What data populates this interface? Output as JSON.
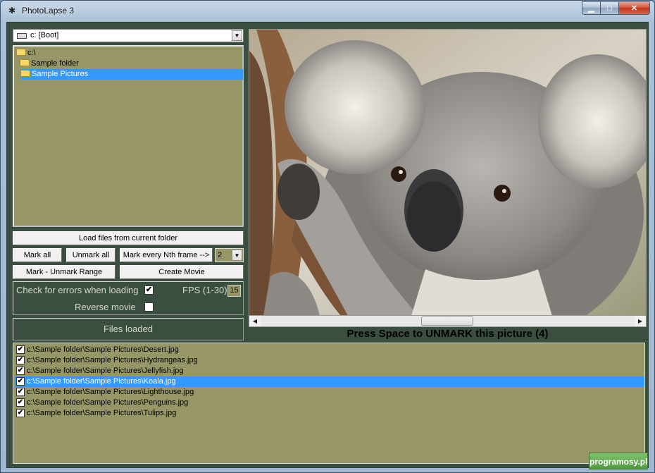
{
  "window": {
    "title": "PhotoLapse 3",
    "icon": "bug-icon",
    "controls": {
      "minimize": "▁",
      "maximize": "□",
      "close": "✕"
    }
  },
  "drive_selector": {
    "value": "c: [Boot]"
  },
  "folder_tree": {
    "items": [
      {
        "label": "c:\\"
      },
      {
        "label": "Sample folder"
      },
      {
        "label": "Sample Pictures",
        "selected": true
      }
    ]
  },
  "buttons": {
    "load_files": "Load files from current folder",
    "mark_all": "Mark all",
    "unmark_all": "Unmark all",
    "mark_every_nth": "Mark every Nth frame -->",
    "mark_unmark_range": "Mark - Unmark Range",
    "create_movie": "Create Movie"
  },
  "nth_frame": {
    "value": "2"
  },
  "options": {
    "check_errors_label": "Check for errors when loading",
    "check_errors_checked": true,
    "fps_label": "FPS (1-30)",
    "fps_value": "15",
    "reverse_label": "Reverse movie",
    "reverse_checked": false
  },
  "status": {
    "text": "Files loaded"
  },
  "preview": {
    "hint": "Press Space to UNMARK this picture (4)"
  },
  "file_list": {
    "files": [
      {
        "path": "c:\\Sample folder\\Sample Pictures\\Desert.jpg",
        "checked": true
      },
      {
        "path": "c:\\Sample folder\\Sample Pictures\\Hydrangeas.jpg",
        "checked": true
      },
      {
        "path": "c:\\Sample folder\\Sample Pictures\\Jellyfish.jpg",
        "checked": true
      },
      {
        "path": "c:\\Sample folder\\Sample Pictures\\Koala.jpg",
        "checked": true,
        "selected": true
      },
      {
        "path": "c:\\Sample folder\\Sample Pictures\\Lighthouse.jpg",
        "checked": true
      },
      {
        "path": "c:\\Sample folder\\Sample Pictures\\Penguins.jpg",
        "checked": true
      },
      {
        "path": "c:\\Sample folder\\Sample Pictures\\Tulips.jpg",
        "checked": true
      }
    ]
  },
  "watermark": {
    "text": "programosy.pl"
  },
  "colors": {
    "panel_bg": "#3a4f40",
    "list_bg": "#969667",
    "selection": "#3399ff"
  }
}
